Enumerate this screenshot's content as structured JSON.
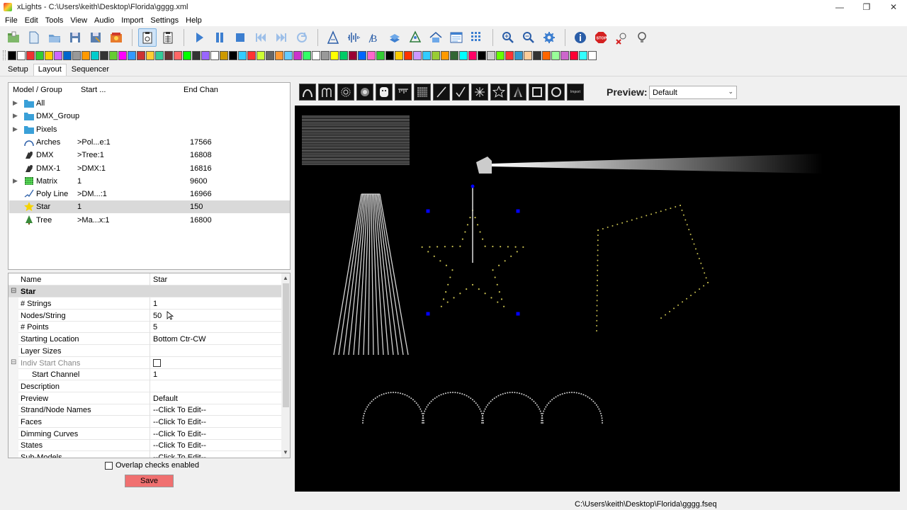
{
  "window": {
    "title": "xLights - C:\\Users\\keith\\Desktop\\Florida\\gggg.xml",
    "controls": [
      "—",
      "❐",
      "✕"
    ]
  },
  "menu": [
    "File",
    "Edit",
    "Tools",
    "View",
    "Audio",
    "Import",
    "Settings",
    "Help"
  ],
  "tabs": [
    "Setup",
    "Layout",
    "Sequencer"
  ],
  "model_list": {
    "headers": {
      "name": "Model / Group",
      "start": "Start ...",
      "end": "End Chan"
    },
    "rows": [
      {
        "name": "All",
        "start": "",
        "end": "",
        "icon": "folder-icon",
        "expandable": true
      },
      {
        "name": "DMX_Group",
        "start": "",
        "end": "",
        "icon": "folder-icon",
        "expandable": true
      },
      {
        "name": "Pixels",
        "start": "",
        "end": "",
        "icon": "folder-icon",
        "expandable": true
      },
      {
        "name": "Arches",
        "start": ">Pol...e:1",
        "end": "17566",
        "icon": "arch-icon",
        "expandable": false
      },
      {
        "name": "DMX",
        "start": ">Tree:1",
        "end": "16808",
        "icon": "dmx-icon",
        "expandable": false
      },
      {
        "name": "DMX-1",
        "start": ">DMX:1",
        "end": "16816",
        "icon": "dmx-icon",
        "expandable": false
      },
      {
        "name": "Matrix",
        "start": "1",
        "end": "9600",
        "icon": "matrix-icon",
        "expandable": true
      },
      {
        "name": "Poly Line",
        "start": ">DM...:1",
        "end": "16966",
        "icon": "polyline-icon",
        "expandable": false
      },
      {
        "name": "Star",
        "start": "1",
        "end": "150",
        "icon": "star-icon",
        "expandable": false,
        "selected": true
      },
      {
        "name": "Tree",
        "start": ">Ma...x:1",
        "end": "16800",
        "icon": "tree-icon",
        "expandable": false
      }
    ]
  },
  "properties": {
    "header": {
      "name": "Name",
      "value": "Star"
    },
    "category": "Star",
    "rows": [
      {
        "name": "# Strings",
        "value": "1"
      },
      {
        "name": "Nodes/String",
        "value": "50"
      },
      {
        "name": "# Points",
        "value": "5"
      },
      {
        "name": "Starting Location",
        "value": "Bottom Ctr-CW"
      },
      {
        "name": "Layer Sizes",
        "value": ""
      },
      {
        "name": "Indiv Start Chans",
        "value": "",
        "checkbox": true,
        "gray": true,
        "collapsible": true
      },
      {
        "name": "Start Channel",
        "value": "1",
        "indent": true
      },
      {
        "name": "Description",
        "value": ""
      },
      {
        "name": "Preview",
        "value": "Default"
      },
      {
        "name": "Strand/Node Names",
        "value": "--Click To Edit--"
      },
      {
        "name": "Faces",
        "value": "--Click To Edit--"
      },
      {
        "name": "Dimming Curves",
        "value": "--Click To Edit--"
      },
      {
        "name": "States",
        "value": "--Click To Edit--"
      },
      {
        "name": "Sub-Models",
        "value": "--Click To Edit--"
      }
    ]
  },
  "overlap_label": "Overlap checks enabled",
  "save_label": "Save",
  "preview": {
    "label": "Preview:",
    "selected": "Default"
  },
  "model_tools": [
    "arch-tool-icon",
    "candy-cane-tool-icon",
    "circle-tool-icon",
    "dmx-tool-icon",
    "face-tool-icon",
    "icicles-tool-icon",
    "matrix-tool-icon",
    "single-line-tool-icon",
    "poly-line-tool-icon",
    "spinner-tool-icon",
    "star-tool-icon",
    "tree-tool-icon",
    "window-frame-tool-icon",
    "wreath-tool-icon"
  ],
  "model_tools_import_label": "Import",
  "status_path": "C:\\Users\\keith\\Desktop\\Florida\\gggg.fseq",
  "colors": {
    "save": "#f07070",
    "canvas": "#000000",
    "selection": "#0000ff"
  }
}
